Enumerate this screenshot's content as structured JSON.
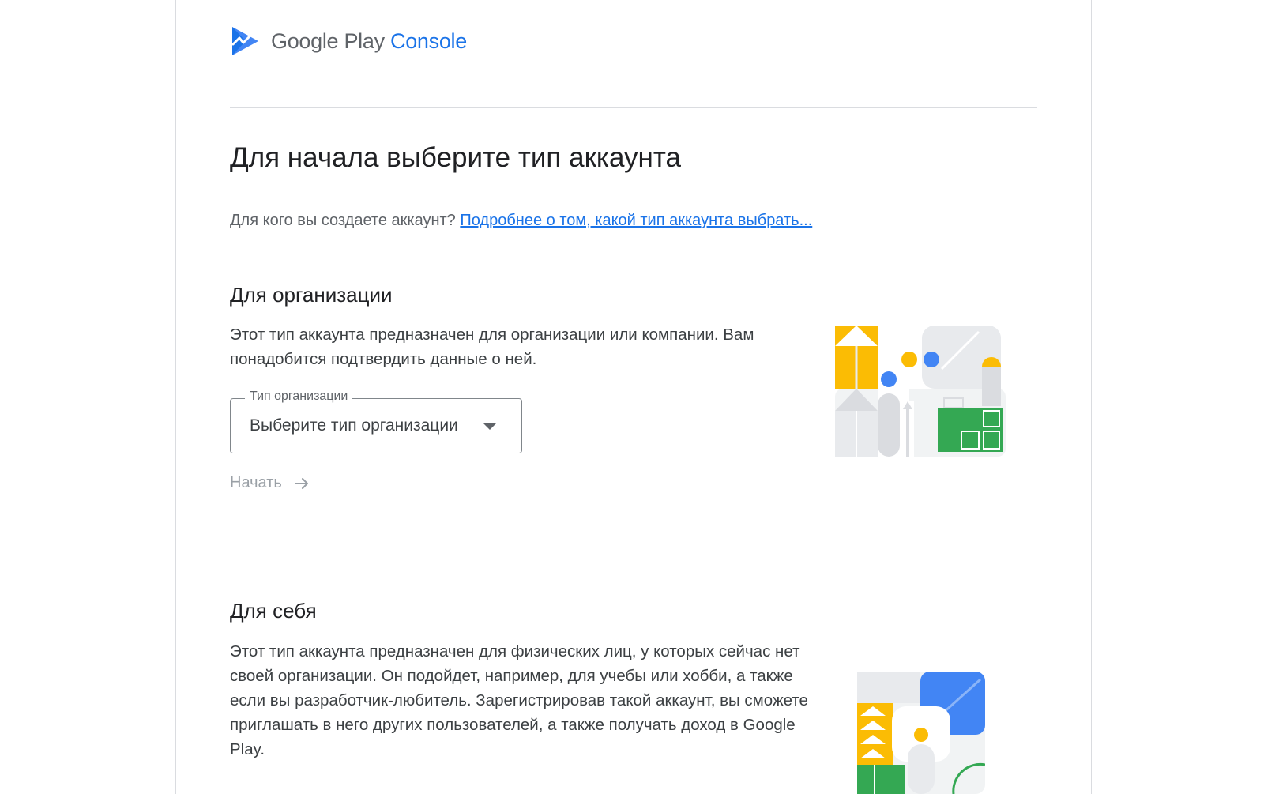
{
  "header": {
    "logo_brand": "Google Play",
    "logo_product": "Console"
  },
  "page": {
    "title": "Для начала выберите тип аккаунта",
    "intro_question": "Для кого вы создаете аккаунт?",
    "intro_link": "Подробнее о том, какой тип аккаунта выбрать..."
  },
  "organization": {
    "title": "Для организации",
    "description": "Этот тип аккаунта предназначен для организации или компании. Вам понадобится подтвердить данные о ней.",
    "select_label": "Тип организации",
    "select_value": "Выберите тип организации",
    "start_label": "Начать",
    "start_disabled": true
  },
  "personal": {
    "title": "Для себя",
    "description": "Этот тип аккаунта предназначен для физических лиц, у которых сейчас нет своей организации. Он подойдет, например, для учебы или хобби, а также если вы разработчик-любитель. Зарегистрировав такой аккаунт, вы сможете приглашать в него других пользователей, а также получать доход в Google Play."
  },
  "colors": {
    "accent_blue": "#1a73e8",
    "logo_blue": "#4285f4",
    "yellow": "#fbbc04",
    "green": "#34a853",
    "grey_light": "#e8eaed",
    "grey_mid": "#dadce0",
    "text_disabled": "#9aa0a6"
  },
  "icons": [
    "play-console-logo-icon",
    "dropdown-arrow-icon",
    "arrow-right-icon",
    "organization-illustration",
    "personal-illustration"
  ]
}
